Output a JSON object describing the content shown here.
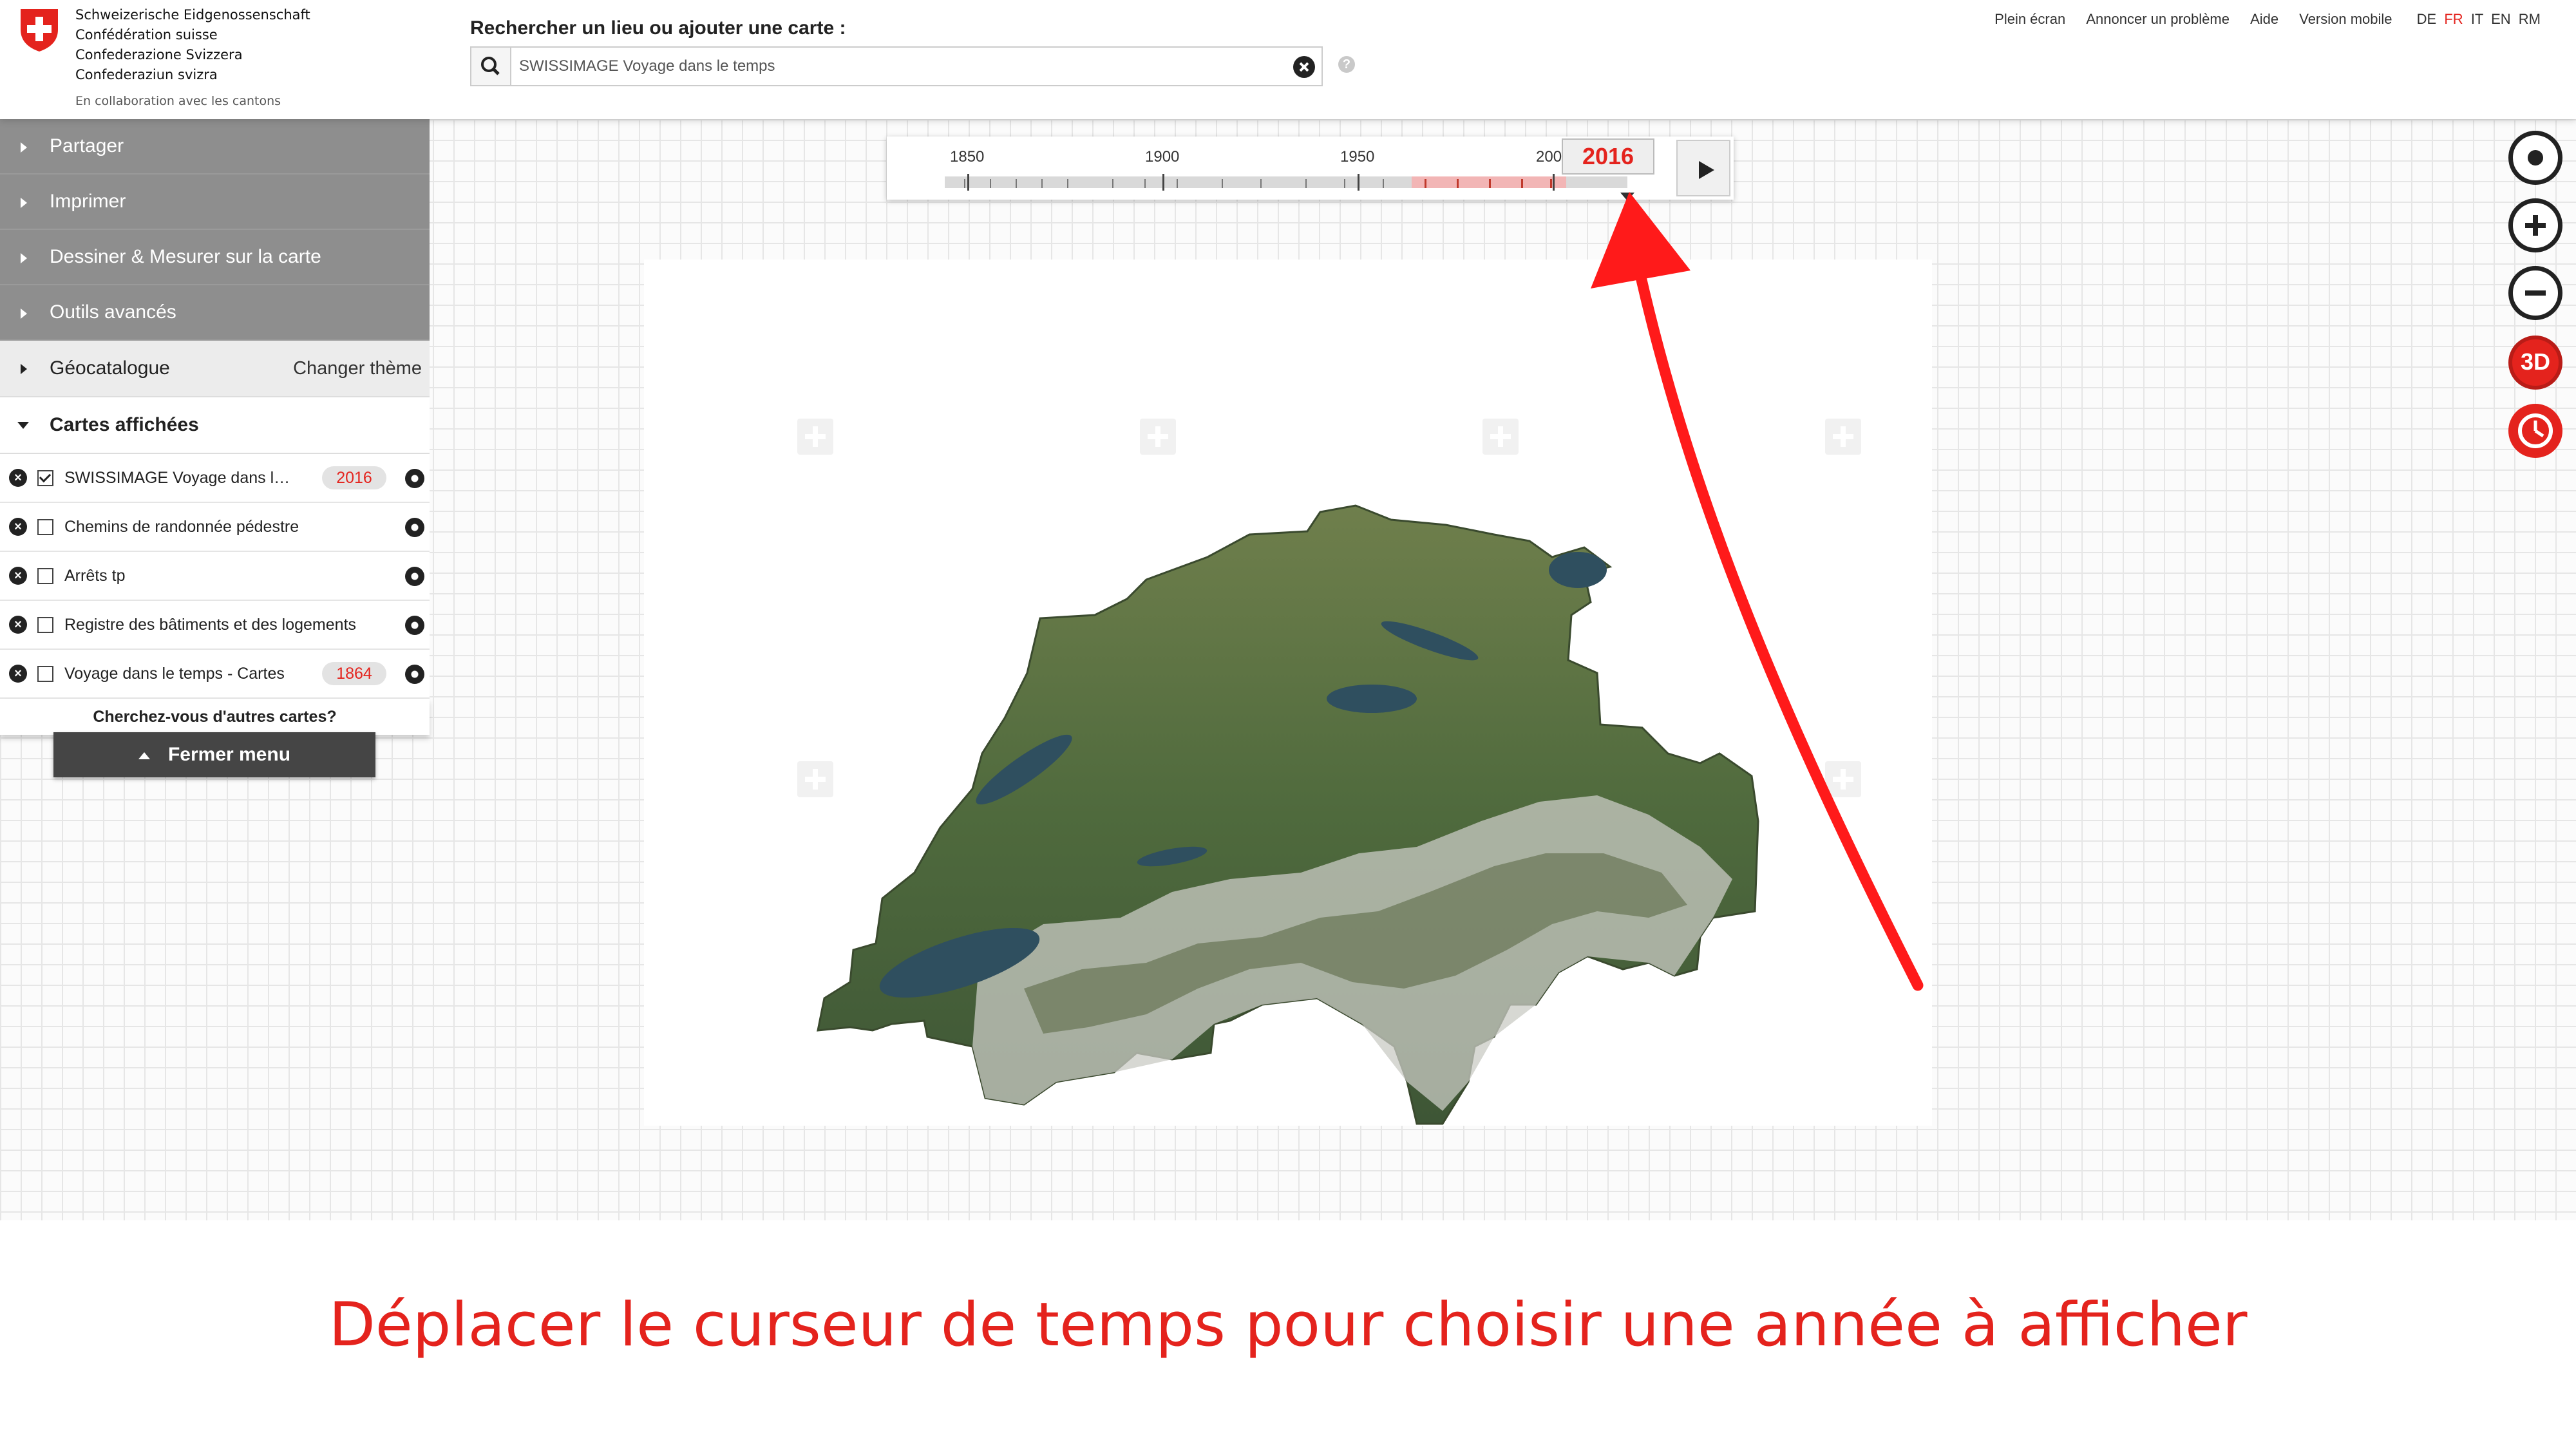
{
  "header": {
    "confederation_lines": [
      "Schweizerische Eidgenossenschaft",
      "Confédération suisse",
      "Confederazione Svizzera",
      "Confederaziun svizra"
    ],
    "collaboration": "En collaboration avec les cantons",
    "search_label": "Rechercher un lieu ou ajouter une carte :",
    "search_value": "SWISSIMAGE Voyage dans le temps",
    "top_links": [
      "Plein écran",
      "Annoncer un problème",
      "Aide",
      "Version mobile"
    ],
    "languages": [
      "DE",
      "FR",
      "IT",
      "EN",
      "RM"
    ],
    "active_language": "FR",
    "help_symbol": "?"
  },
  "timeline": {
    "tick_labels": [
      "1850",
      "1900",
      "1950",
      "200"
    ],
    "selected_year": "2016"
  },
  "menu": {
    "items": [
      "Partager",
      "Imprimer",
      "Dessiner & Mesurer sur la carte",
      "Outils avancés"
    ],
    "geocatalogue": "Géocatalogue",
    "change_theme": "Changer thème",
    "displayed_maps_title": "Cartes affichées",
    "layers": [
      {
        "name": "SWISSIMAGE Voyage dans le temps",
        "checked": true,
        "year": "2016"
      },
      {
        "name": "Chemins de randonnée pédestre",
        "checked": false
      },
      {
        "name": "Arrêts tp",
        "checked": false
      },
      {
        "name": "Registre des bâtiments et des logements",
        "checked": false
      },
      {
        "name": "Voyage dans le temps - Cartes",
        "checked": false,
        "year": "1864"
      }
    ],
    "more_maps": "Cherchez-vous d'autres cartes?",
    "close_menu": "Fermer menu"
  },
  "tools": {
    "threed_label": "3D"
  },
  "caption": "Déplacer le curseur de temps pour choisir une année à afficher",
  "colors": {
    "accent_red": "#e4231d",
    "menu_gray": "#8e8e8e"
  }
}
